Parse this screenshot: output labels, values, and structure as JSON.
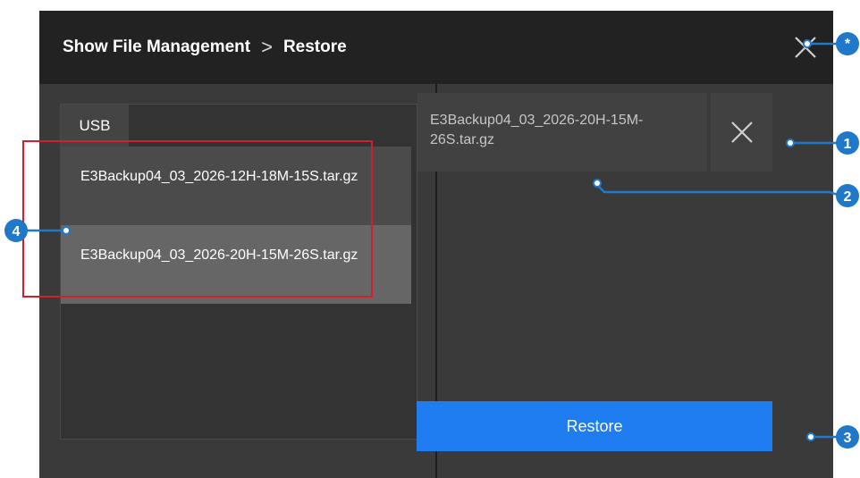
{
  "header": {
    "breadcrumb": [
      "Show File Management",
      "Restore"
    ],
    "separator": ">"
  },
  "icons": {
    "close": "close-icon",
    "remove": "remove-file-icon"
  },
  "left_panel": {
    "tab_label": "USB",
    "files": [
      "E3Backup04_03_2026-12H-18M-15S.tar.gz",
      "E3Backup04_03_2026-20H-15M-26S.tar.gz"
    ]
  },
  "right_panel": {
    "selected_file": "E3Backup04_03_2026-20H-15M-26S.tar.gz",
    "restore_label": "Restore"
  },
  "callouts": {
    "star": "*",
    "one": "1",
    "two": "2",
    "three": "3",
    "four": "4"
  },
  "colors": {
    "accent": "#1f7cf1",
    "callout": "#1f78c8",
    "highlight_frame": "#d1202b"
  }
}
